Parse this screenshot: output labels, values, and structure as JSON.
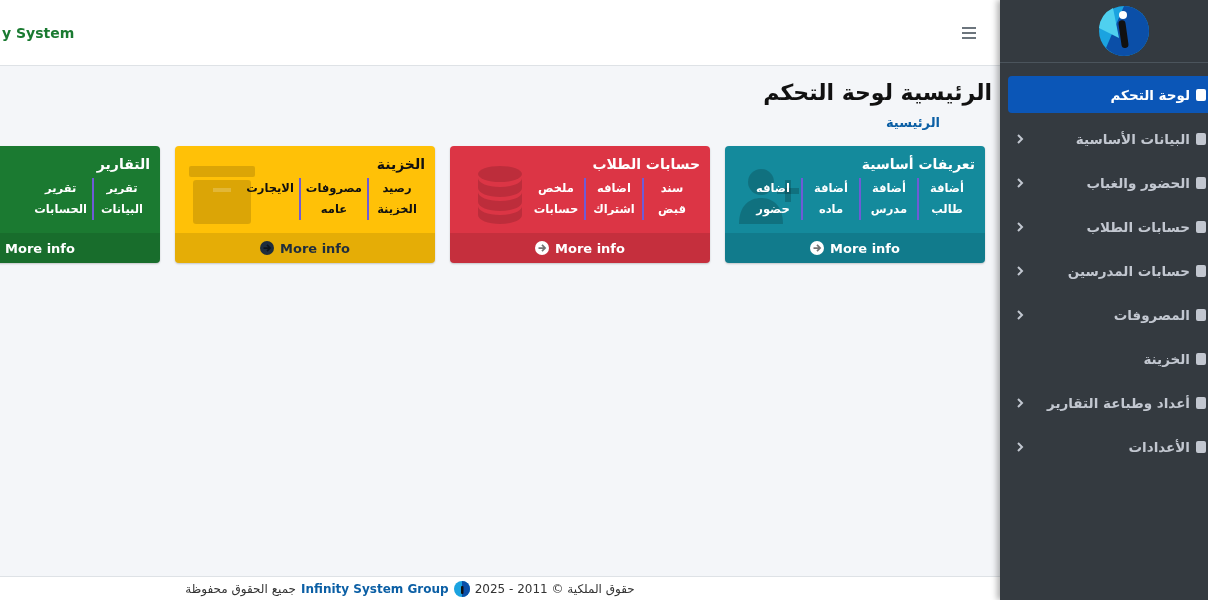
{
  "header": {
    "brand": "y System"
  },
  "page": {
    "title": "الرئيسية لوحة التحكم",
    "breadcrumb": "الرئيسية"
  },
  "cards": [
    {
      "title": "تعريفات أساسية",
      "color": "#148a9c",
      "links": [
        "أضافة طالب",
        "أضافة مدرس",
        "أضافة ماده",
        "اضافه حضور"
      ],
      "more": "More info"
    },
    {
      "title": "حسابات الطلاب",
      "color": "#dc3545",
      "links": [
        "سند قبض",
        "اضافه اشتراك",
        "ملخص حسابات"
      ],
      "more": "More info"
    },
    {
      "title": "الخزينة",
      "color": "#ffc107",
      "links": [
        "رصيد الخزينة",
        "مصروفات عامه",
        "الايجارت"
      ],
      "more": "More info"
    },
    {
      "title": "التقارير",
      "color": "#1b7a31",
      "links": [
        "تقرير البيانات",
        "تقرير الحسابات"
      ],
      "more": "More info"
    }
  ],
  "sidebar": {
    "items": [
      {
        "label": "لوحة التحكم",
        "selected": true,
        "expandable": false
      },
      {
        "label": "البيانات الأساسية",
        "selected": false,
        "expandable": true
      },
      {
        "label": "الحضور والغياب",
        "selected": false,
        "expandable": true
      },
      {
        "label": "حسابات الطلاب",
        "selected": false,
        "expandable": true
      },
      {
        "label": "حسابات المدرسين",
        "selected": false,
        "expandable": true
      },
      {
        "label": "المصروفات",
        "selected": false,
        "expandable": true
      },
      {
        "label": "الخزينة",
        "selected": false,
        "expandable": false
      },
      {
        "label": "أعداد وطباعة التقارير",
        "selected": false,
        "expandable": true
      },
      {
        "label": "الأعدادات",
        "selected": false,
        "expandable": true
      }
    ]
  },
  "footer": {
    "rights": "حقوق الملكية © 2011 - 2025",
    "company": "Infinity System Group",
    "reserved": "جميع الحقوق محفوظة"
  }
}
